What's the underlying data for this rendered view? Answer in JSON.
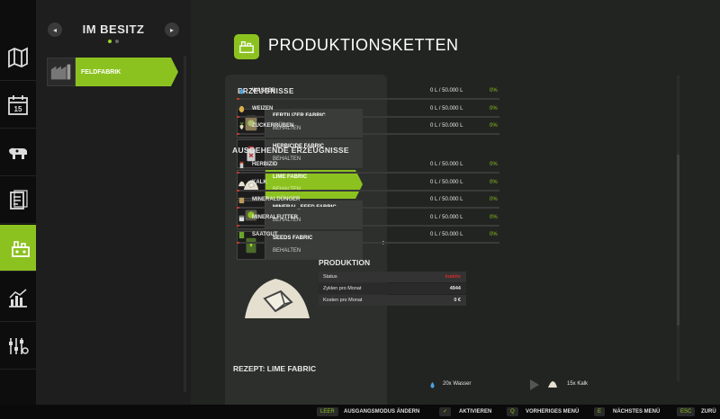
{
  "sidebar": {
    "icons": [
      "map-icon",
      "calendar-icon",
      "animals-icon",
      "contracts-icon",
      "production-icon",
      "statistics-icon",
      "settings-icon"
    ],
    "calendar_day": "15",
    "accent": "#8cc21f"
  },
  "owned": {
    "title": "IM BESITZ",
    "prev": "◂",
    "next": "▸",
    "items": [
      {
        "label": "FELDFABRIK"
      }
    ]
  },
  "page": {
    "title": "PRODUKTIONSKETTEN"
  },
  "products": {
    "header": "ERZEUGNISSE",
    "items": [
      {
        "name": "FERTILIZER FABRIC",
        "status": "BEHALTEN"
      },
      {
        "name": "HERBICIDE FABRIC",
        "status": "BEHALTEN"
      },
      {
        "name": "LIME FABRIC",
        "status": "BEHALTEN",
        "selected": true
      },
      {
        "name": "MINERAL_FEED FABRIC",
        "status": "BEHALTEN"
      },
      {
        "name": "SEEDS FABRIC",
        "status": "BEHALTEN"
      }
    ]
  },
  "inputs": [
    {
      "name": "WASSER",
      "amount": "0 L / 50.000 L",
      "pct": "0%"
    },
    {
      "name": "WEIZEN",
      "amount": "0 L / 50.000 L",
      "pct": "0%"
    },
    {
      "name": "ZUCKERRÜBEN",
      "amount": "0 L / 50.000 L",
      "pct": "0%"
    }
  ],
  "outputs_header": "AUSGEHENDE ERZEUGNISSE",
  "outputs": [
    {
      "name": "HERBIZID",
      "amount": "0 L / 50.000 L",
      "pct": "0%"
    },
    {
      "name": "KALK",
      "amount": "0 L / 50.000 L",
      "pct": "0%"
    },
    {
      "name": "MINERALDÜNGER",
      "amount": "0 L / 50.000 L",
      "pct": "0%"
    },
    {
      "name": "MINERALFUTTER",
      "amount": "0 L / 50.000 L",
      "pct": "0%"
    },
    {
      "name": "SAATGUT",
      "amount": "0 L / 50.000 L",
      "pct": "0%"
    }
  ],
  "production": {
    "header": "PRODUKTION",
    "status_label": "Status",
    "status_value": "Inaktiv",
    "status_color": "#d12b2b",
    "cycles_label": "Zyklen pro Monat",
    "cycles_value": "4944",
    "cost_label": "Kosten pro Monat",
    "cost_value": "0 €"
  },
  "recipe": {
    "header": "REZEPT: LIME FABRIC",
    "input": "20x Wasser",
    "output": "15x Kalk"
  },
  "bottom_bar": [
    {
      "key": "LEER",
      "label": "AUSGANGSMODUS ÄNDERN"
    },
    {
      "key": "✓",
      "label": "AKTIVIEREN"
    },
    {
      "key": "Q",
      "label": "VORHERIGES MENÜ"
    },
    {
      "key": "E",
      "label": "NÄCHSTES MENÜ"
    },
    {
      "key": "ESC",
      "label": "ZURÜ"
    }
  ]
}
